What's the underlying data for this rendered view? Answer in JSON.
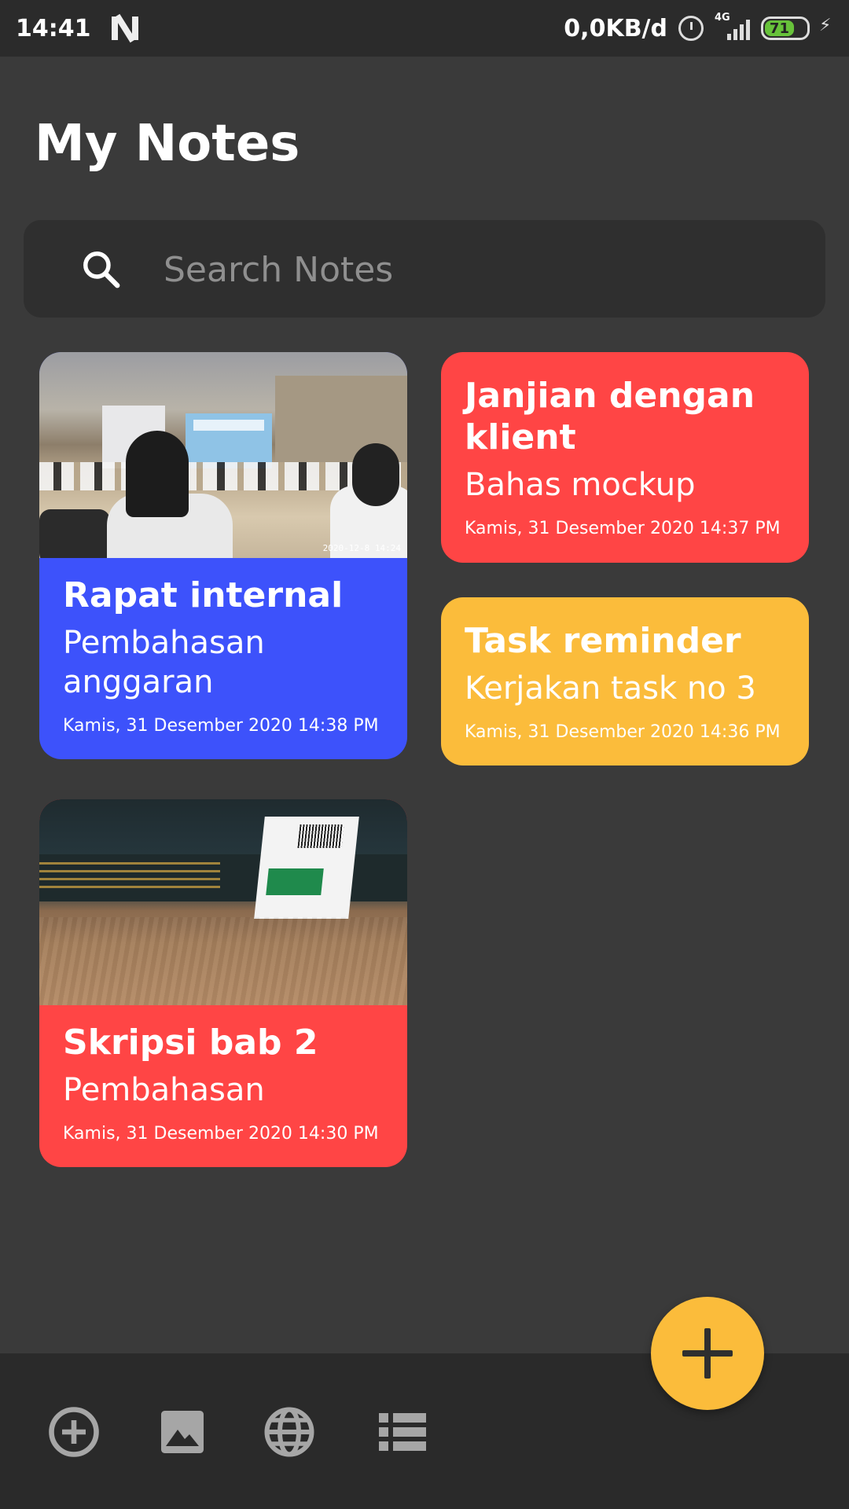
{
  "status_bar": {
    "time": "14:41",
    "network_speed": "0,0KB/d",
    "network_type": "4G",
    "battery_level": "71",
    "icons": [
      "n-logo-icon",
      "alarm-icon",
      "signal-icon",
      "battery-icon",
      "charging-icon"
    ]
  },
  "header": {
    "title": "My Notes"
  },
  "search": {
    "placeholder": "Search Notes",
    "value": "",
    "icon": "search-icon"
  },
  "notes": [
    {
      "title": "Rapat internal",
      "subtitle": "Pembahasan anggaran",
      "date": "Kamis, 31 Desember 2020 14:38 PM",
      "color": "#3d52fb",
      "image": "meeting-photo",
      "image_stamp": "2020-12-8 14:24"
    },
    {
      "title": "Janjian dengan klient",
      "subtitle": "Bahas mockup",
      "date": "Kamis, 31 Desember 2020 14:37 PM",
      "color": "#ff4545"
    },
    {
      "title": "Task reminder",
      "subtitle": "Kerjakan task no 3",
      "date": "Kamis, 31 Desember 2020 14:36 PM",
      "color": "#fbbc3b"
    },
    {
      "title": "Skripsi bab 2",
      "subtitle": "Pembahasan",
      "date": "Kamis, 31 Desember 2020 14:30 PM",
      "color": "#ff4545",
      "image": "book-photo"
    }
  ],
  "fab": {
    "icon": "plus-icon",
    "color": "#fbbc3b"
  },
  "bottom_bar": {
    "icons": [
      "add-circle-icon",
      "image-icon",
      "globe-icon",
      "list-icon"
    ]
  },
  "colors": {
    "background": "#3a3a3a",
    "surface": "#2f2f2f",
    "accent": "#fbbc3b",
    "hint": "#8f8f8f"
  }
}
